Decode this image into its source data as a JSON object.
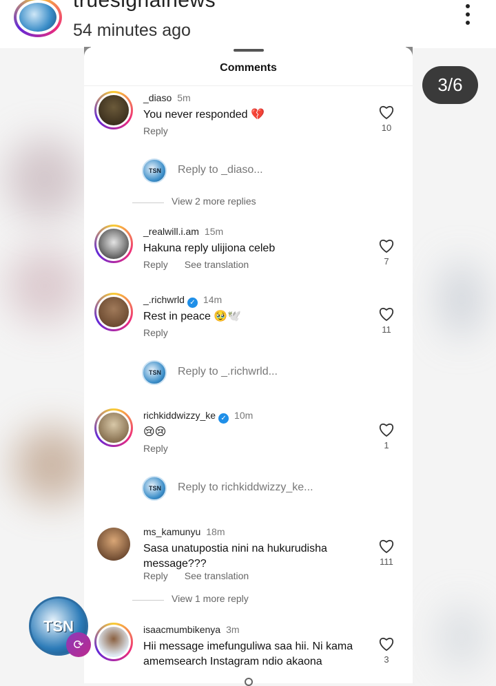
{
  "header": {
    "username": "truesignalnews",
    "time": "54 minutes ago",
    "page_indicator": "3/6"
  },
  "sheet": {
    "title": "Comments"
  },
  "comments": [
    {
      "user": "_diaso",
      "time": "5m",
      "verified": false,
      "text": "You never responded 💔",
      "likes": "10",
      "actions": [
        "Reply"
      ],
      "reply_placeholder": "Reply to _diaso...",
      "more_replies": "View 2 more replies"
    },
    {
      "user": "_realwill.i.am",
      "time": "15m",
      "verified": false,
      "text": "Hakuna reply ulijiona celeb",
      "likes": "7",
      "actions": [
        "Reply",
        "See translation"
      ]
    },
    {
      "user": "_.richwrld",
      "time": "14m",
      "verified": true,
      "text": "Rest in peace 🥹🕊️",
      "likes": "11",
      "actions": [
        "Reply"
      ],
      "reply_placeholder": "Reply to _.richwrld..."
    },
    {
      "user": "richkiddwizzy_ke",
      "time": "10m",
      "verified": true,
      "text": "😢😢",
      "likes": "1",
      "actions": [
        "Reply"
      ],
      "reply_placeholder": "Reply to richkiddwizzy_ke..."
    },
    {
      "user": "ms_kamunyu",
      "time": "18m",
      "verified": false,
      "text": "Sasa unatupostia nini na hukurudisha message???",
      "likes": "111",
      "actions": [
        "Reply",
        "See translation"
      ],
      "more_replies": "View 1 more reply"
    },
    {
      "user": "isaacmumbikenya",
      "time": "3m",
      "verified": false,
      "text": "Hii message imefunguliwa saa hii. Ni kama amemsearch Instagram ndio akaona",
      "likes": "3",
      "actions": []
    }
  ],
  "floating_logo": {
    "label": "TSN"
  },
  "colors": {
    "accent_ring": "#ee2a7b",
    "verified": "#1f8fe8",
    "badge_bg": "#3a3a3a"
  }
}
